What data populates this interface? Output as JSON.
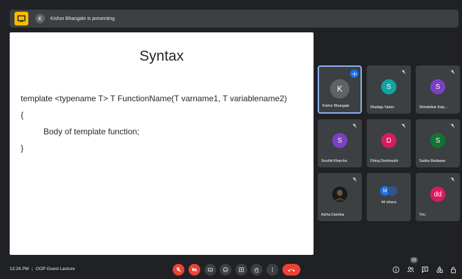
{
  "presenting_bar": {
    "avatar_letter": "K",
    "text": "Kishor Bhangale is presenting"
  },
  "slide": {
    "title": "Syntax",
    "lines": [
      "template <typename T> T FunctionName(T varname1, T variablename2)",
      "{",
      "Body of template function;",
      "}"
    ]
  },
  "participants": [
    {
      "name": "Kishor Bhangale",
      "initial": "K",
      "color": "#5f6368",
      "speaking": true,
      "muted": false
    },
    {
      "name": "Shailaja Yadav",
      "initial": "S",
      "color": "#12a4a0",
      "speaking": false,
      "muted": true
    },
    {
      "name": "Shindalkar Kaly...",
      "initial": "S",
      "color": "#7b3fc4",
      "speaking": false,
      "muted": true
    },
    {
      "name": "Srushti Kharche",
      "initial": "S",
      "color": "#7b3fc4",
      "speaking": false,
      "muted": true
    },
    {
      "name": "Dhiraj Deshmukh",
      "initial": "D",
      "color": "#d81b60",
      "speaking": false,
      "muted": true
    },
    {
      "name": "Sarika Madawar",
      "initial": "S",
      "color": "#137333",
      "speaking": false,
      "muted": true
    },
    {
      "name": "Astha Darekar",
      "initial": "",
      "color": "#202124",
      "speaking": false,
      "muted": true
    },
    {
      "name": "44 others",
      "initial": "",
      "color": "#3c4043",
      "speaking": false,
      "muted": false
    },
    {
      "name": "You",
      "initial": "dd",
      "color": "#d81b60",
      "speaking": false,
      "muted": true
    }
  ],
  "others_avatars": [
    {
      "initial": "M",
      "color": "#1a73e8"
    },
    {
      "initial": "",
      "color": "#34558b"
    }
  ],
  "bottom": {
    "time": "12:26 PM",
    "meeting_name": "OOP Guest Lecture",
    "people_count": "53"
  },
  "icons": {
    "controls": [
      "mic-off-icon",
      "camera-off-icon",
      "captions-icon",
      "emoji-icon",
      "present-icon",
      "raise-hand-icon",
      "more-options-icon",
      "leave-call-icon"
    ],
    "side": [
      "info-icon",
      "people-icon",
      "chat-icon",
      "activities-icon",
      "lock-icon"
    ]
  },
  "colors": {
    "background": "#202124",
    "surface": "#3c4043",
    "danger": "#ea4335",
    "accent": "#8ab4f8",
    "present_yellow": "#fbbc04"
  }
}
